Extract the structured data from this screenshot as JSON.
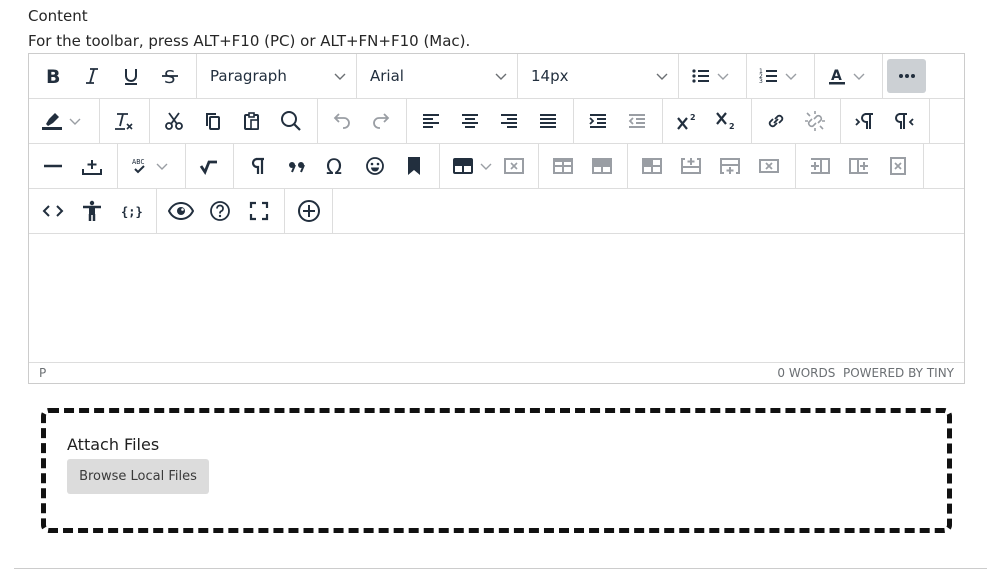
{
  "field_label": "Content",
  "toolbar_hint": "For the toolbar, press ALT+F10 (PC) or ALT+FN+F10 (Mac).",
  "toolbar": {
    "block_format": "Paragraph",
    "font_family": "Arial",
    "font_size": "14px",
    "spellcheck_label": "ABC"
  },
  "statusbar": {
    "path": "P",
    "word_count": "0 WORDS",
    "branding": "POWERED BY TINY"
  },
  "attach": {
    "label": "Attach Files",
    "browse_button": "Browse Local Files"
  },
  "colors": {
    "icon": "#222f3e",
    "disabled_icon": "#9a9ea4",
    "active_button_bg": "#ccd0d4",
    "browse_button_bg": "#dcdcdc"
  }
}
